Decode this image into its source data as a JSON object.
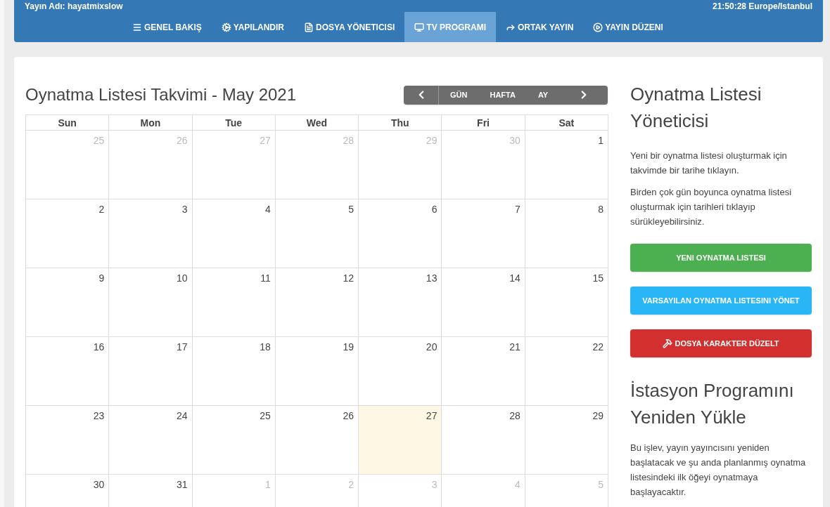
{
  "header": {
    "station": "Yayın Adı: hayatmixslow",
    "clock": "21:50:28 Europe/Istanbul"
  },
  "nav": [
    {
      "label": "GENEL BAKIŞ",
      "selected": false
    },
    {
      "label": "YAPILANDIR",
      "selected": false
    },
    {
      "label": "DOSYA YÖNETICISI",
      "selected": false
    },
    {
      "label": "TV PROGRAMI",
      "selected": true
    },
    {
      "label": "ORTAK YAYIN",
      "selected": false
    },
    {
      "label": "YAYIN DÜZENI",
      "selected": false
    }
  ],
  "calendar": {
    "title": "Oynatma Listesi Takvimi - May 2021",
    "views": [
      {
        "label": "GÜN",
        "selected": false
      },
      {
        "label": "HAFTA",
        "selected": false
      },
      {
        "label": "AY",
        "selected": false
      }
    ],
    "weekdays": [
      "Sun",
      "Mon",
      "Tue",
      "Wed",
      "Thu",
      "Fri",
      "Sat"
    ],
    "weeks": [
      [
        {
          "day": "25",
          "other_month": true,
          "today": false
        },
        {
          "day": "26",
          "other_month": true,
          "today": false
        },
        {
          "day": "27",
          "other_month": true,
          "today": false
        },
        {
          "day": "28",
          "other_month": true,
          "today": false
        },
        {
          "day": "29",
          "other_month": true,
          "today": false
        },
        {
          "day": "30",
          "other_month": true,
          "today": false
        },
        {
          "day": "1",
          "other_month": false,
          "today": false
        }
      ],
      [
        {
          "day": "2",
          "other_month": false,
          "today": false
        },
        {
          "day": "3",
          "other_month": false,
          "today": false
        },
        {
          "day": "4",
          "other_month": false,
          "today": false
        },
        {
          "day": "5",
          "other_month": false,
          "today": false
        },
        {
          "day": "6",
          "other_month": false,
          "today": false
        },
        {
          "day": "7",
          "other_month": false,
          "today": false
        },
        {
          "day": "8",
          "other_month": false,
          "today": false
        }
      ],
      [
        {
          "day": "9",
          "other_month": false,
          "today": false
        },
        {
          "day": "10",
          "other_month": false,
          "today": false
        },
        {
          "day": "11",
          "other_month": false,
          "today": false
        },
        {
          "day": "12",
          "other_month": false,
          "today": false
        },
        {
          "day": "13",
          "other_month": false,
          "today": false
        },
        {
          "day": "14",
          "other_month": false,
          "today": false
        },
        {
          "day": "15",
          "other_month": false,
          "today": false
        }
      ],
      [
        {
          "day": "16",
          "other_month": false,
          "today": false
        },
        {
          "day": "17",
          "other_month": false,
          "today": false
        },
        {
          "day": "18",
          "other_month": false,
          "today": false
        },
        {
          "day": "19",
          "other_month": false,
          "today": false
        },
        {
          "day": "20",
          "other_month": false,
          "today": false
        },
        {
          "day": "21",
          "other_month": false,
          "today": false
        },
        {
          "day": "22",
          "other_month": false,
          "today": false
        }
      ],
      [
        {
          "day": "23",
          "other_month": false,
          "today": false
        },
        {
          "day": "24",
          "other_month": false,
          "today": false
        },
        {
          "day": "25",
          "other_month": false,
          "today": false
        },
        {
          "day": "26",
          "other_month": false,
          "today": false
        },
        {
          "day": "27",
          "other_month": false,
          "today": true
        },
        {
          "day": "28",
          "other_month": false,
          "today": false
        },
        {
          "day": "29",
          "other_month": false,
          "today": false
        }
      ],
      [
        {
          "day": "30",
          "other_month": false,
          "today": false
        },
        {
          "day": "31",
          "other_month": false,
          "today": false
        },
        {
          "day": "1",
          "other_month": true,
          "today": false
        },
        {
          "day": "2",
          "other_month": true,
          "today": false
        },
        {
          "day": "3",
          "other_month": true,
          "today": false
        },
        {
          "day": "4",
          "other_month": true,
          "today": false
        },
        {
          "day": "5",
          "other_month": true,
          "today": false
        }
      ]
    ]
  },
  "manager": {
    "title": "Oynatma Listesi Yöneticisi",
    "paragraphs": [
      "Yeni bir oynatma listesi oluşturmak için takvimde bir tarihe tıklayın.",
      "Birden çok gün boyunca oynatma listesi oluşturmak için tarihleri tıklayıp sürükleyebilirsiniz."
    ],
    "buttons": [
      {
        "label": "YENI OYNATMA LISTESI",
        "kind": "success"
      },
      {
        "label": "VARSAYILAN OYNATMA LISTESINI YÖNET",
        "kind": "info"
      },
      {
        "label": "DOSYA KARAKTER DÜZELT",
        "kind": "danger"
      }
    ]
  },
  "reload": {
    "title": "İstasyon Programını Yeniden Yükle",
    "text": "Bu işlev, yayın yayıncısını yeniden başlatacak ve şu anda planlanmış oynatma listesindeki ilk öğeyi oynatmaya başlayacaktır."
  }
}
